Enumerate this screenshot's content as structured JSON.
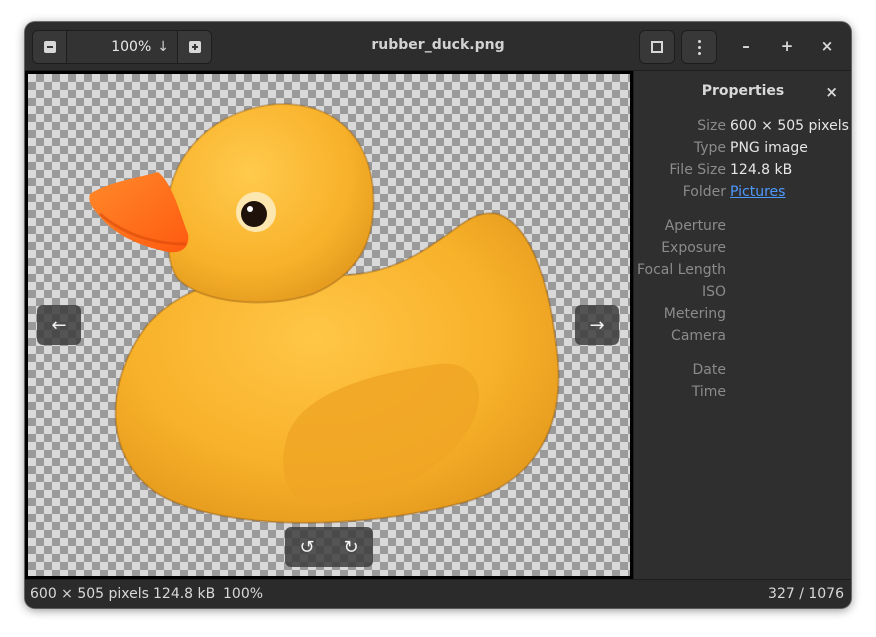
{
  "header": {
    "zoom_value": "100%",
    "zoom_dropdown_icon": "arrow-down-icon",
    "title": "rubber_duck.png"
  },
  "viewer": {
    "prev_icon": "←",
    "next_icon": "→",
    "rotate_left_icon": "↺",
    "rotate_right_icon": "↻"
  },
  "properties": {
    "title": "Properties",
    "close_icon": "×",
    "rows": [
      {
        "key": "Size",
        "value": "600 × 505 pixels"
      },
      {
        "key": "Type",
        "value": "PNG image"
      },
      {
        "key": "File Size",
        "value": "124.8 kB"
      },
      {
        "key": "Folder",
        "value": "Pictures"
      }
    ],
    "exif_rows": [
      {
        "key": "Aperture",
        "value": ""
      },
      {
        "key": "Exposure",
        "value": ""
      },
      {
        "key": "Focal Length",
        "value": ""
      },
      {
        "key": "ISO",
        "value": ""
      },
      {
        "key": "Metering",
        "value": ""
      },
      {
        "key": "Camera",
        "value": ""
      }
    ],
    "date_rows": [
      {
        "key": "Date",
        "value": ""
      },
      {
        "key": "Time",
        "value": ""
      }
    ]
  },
  "window_controls": {
    "minimize": "–",
    "maximize": "+",
    "close": "×"
  },
  "status": {
    "dimensions": "600 × 505 pixels",
    "file_size": "124.8 kB",
    "zoom": "100%",
    "position": "327 / 1076"
  },
  "colors": {
    "accent_link": "#4d9aff",
    "duck_body": "#f8b12a",
    "duck_beak": "#ff6a16"
  }
}
